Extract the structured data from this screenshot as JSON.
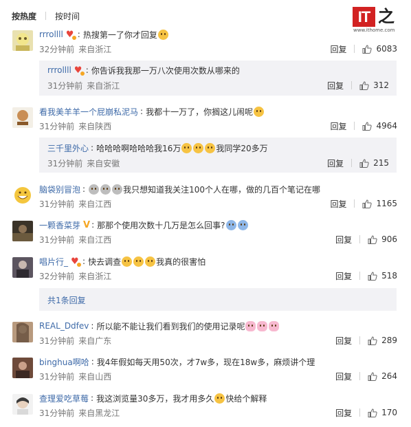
{
  "sort": {
    "active": "按热度",
    "other": "按时间"
  },
  "logo": {
    "mark": "IT",
    "char": "之家",
    "url": "www.ithome.com"
  },
  "colors": {
    "username": "#3e6aa8",
    "meta": "#777777",
    "text": "#333333",
    "sub_bg": "#f2f2f5",
    "badge_red": "#e8453c",
    "badge_gold": "#f5a623"
  },
  "comments": [
    {
      "user": "rrrollll",
      "text": "热搜第一了你才回复",
      "emojis": [
        "smile-emoji"
      ],
      "time": "32分钟前",
      "location": "来自浙江",
      "reply_label": "回复",
      "likes": "6083",
      "badge": "heart-badge",
      "sub": {
        "user": "rrrollll",
        "text": "你告诉我我那一万八次使用次数从哪来的",
        "time": "31分钟前",
        "location": "来自浙江",
        "reply_label": "回复",
        "likes": "312"
      }
    },
    {
      "user": "看我美羊羊一个屁崩私泥马",
      "text": "我都十一万了，你搁这儿闹呢",
      "emojis": [
        "laugh-emoji"
      ],
      "time": "31分钟前",
      "location": "来自陕西",
      "reply_label": "回复",
      "likes": "4964",
      "sub": {
        "user": "三千里外心",
        "text_pre": "哈哈哈啊哈哈哈我16万",
        "text_post": "我同学20多万",
        "emojis": [
          "thumbs-emoji",
          "thumbs-emoji",
          "thumbs-emoji"
        ],
        "time": "31分钟前",
        "location": "来自安徽",
        "reply_label": "回复",
        "likes": "215"
      }
    },
    {
      "user": "脑袋别冒泡",
      "text_pre": "",
      "text_post": "我只想知道我关注100个人在哪，做的几百个笔记在哪",
      "emojis": [
        "shock-emoji",
        "shock-emoji",
        "shock-emoji"
      ],
      "time": "31分钟前",
      "location": "来自江西",
      "reply_label": "回复",
      "likes": "1165"
    },
    {
      "user": "一颗香菜芽",
      "text": "那那个使用次数十几万是怎么回事?",
      "emojis": [
        "cry-emoji",
        "cry-emoji"
      ],
      "time": "31分钟前",
      "location": "来自江西",
      "reply_label": "回复",
      "likes": "906"
    },
    {
      "user": "唱片行_",
      "text_pre": "快去调查",
      "text_post": "我真的很害怕",
      "emojis": [
        "scared-emoji",
        "scared-emoji",
        "scared-emoji"
      ],
      "time": "32分钟前",
      "location": "来自浙江",
      "reply_label": "回复",
      "likes": "518",
      "more_replies": "共1条回复"
    },
    {
      "user": "REAL_Ddfev",
      "text": "所以能不能让我们看到我们的使用记录呢",
      "emojis": [
        "pig-emoji",
        "pig-emoji",
        "pig-emoji"
      ],
      "time": "31分钟前",
      "location": "来自广东",
      "reply_label": "回复",
      "likes": "289"
    },
    {
      "user": "binghua啊哈",
      "text": "我4年假如每天用50次，才7w多，现在18w多，麻烦讲个理",
      "time": "31分钟前",
      "location": "来自山西",
      "reply_label": "回复",
      "likes": "264"
    },
    {
      "user": "查理爱吃草莓",
      "text_pre": "我这浏览量30多万，我才用多久",
      "text_post": "快给个解释",
      "emojis": [
        "cry-emoji"
      ],
      "time": "31分钟前",
      "location": "来自黑龙江",
      "reply_label": "回复",
      "likes": "170"
    }
  ]
}
